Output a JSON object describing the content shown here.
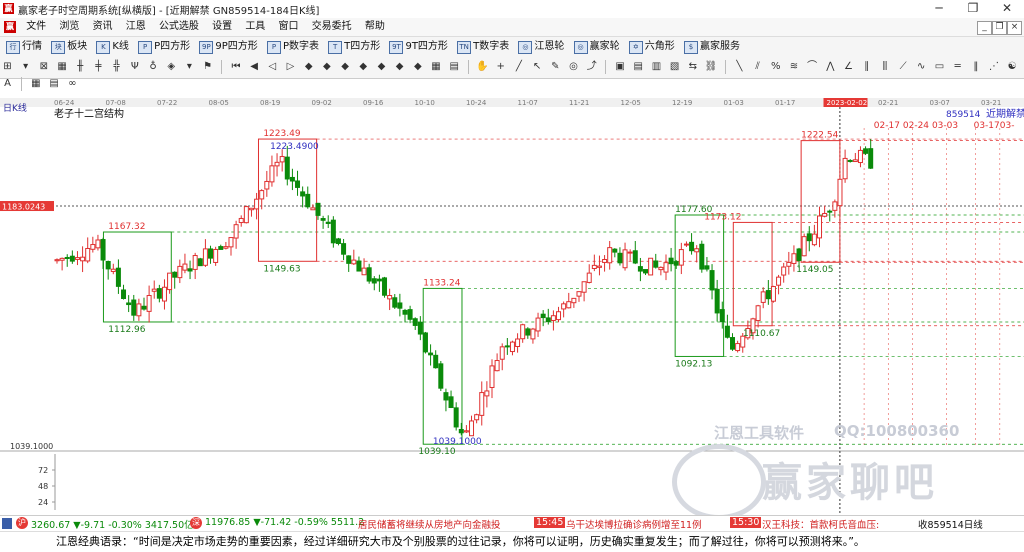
{
  "window": {
    "title": "赢家老子时空周期系统[纵横版] - [近期解禁  GN859514-184日K线]",
    "minimize": "─",
    "maximize": "❐",
    "close": "✕"
  },
  "menu": {
    "items": [
      "文件",
      "浏览",
      "资讯",
      "江恩",
      "公式选股",
      "设置",
      "工具",
      "窗口",
      "交易委托",
      "帮助"
    ]
  },
  "toolbar1": {
    "items": [
      {
        "icon": "行",
        "label": "行情"
      },
      {
        "icon": "块",
        "label": "板块"
      },
      {
        "icon": "K",
        "label": "K线"
      },
      {
        "icon": "P",
        "label": "P四方形"
      },
      {
        "icon": "9P",
        "label": "9P四方形"
      },
      {
        "icon": "P",
        "label": "P数字表"
      },
      {
        "icon": "T",
        "label": "T四方形"
      },
      {
        "icon": "9T",
        "label": "9T四方形"
      },
      {
        "icon": "TN",
        "label": "T数字表"
      },
      {
        "icon": "◎",
        "label": "江恩轮"
      },
      {
        "icon": "◎",
        "label": "赢家轮"
      },
      {
        "icon": "✡",
        "label": "六角形"
      },
      {
        "icon": "$",
        "label": "赢家服务"
      }
    ]
  },
  "chart_data": {
    "type": "candlestick",
    "title": "老子十二宫结构",
    "period_label": "日K线",
    "symbol_label": "859514",
    "name_label": "近期解禁",
    "x_ticks": [
      "06-24",
      "07-08",
      "07-22",
      "08-05",
      "08-19",
      "09-02",
      "09-16",
      "10-10",
      "10-24",
      "11-07",
      "11-21",
      "12-05",
      "12-19",
      "01-03",
      "01-17",
      "2023-02-02",
      "02-21",
      "03-07",
      "03-21"
    ],
    "y_ticks": [
      "1039.1000",
      "72",
      "48",
      "24"
    ],
    "y_range": [
      1035,
      1235
    ],
    "current_price_label": "1183.0243",
    "current_price": 1183.0243,
    "price_labels": [
      {
        "text": "1223.49",
        "price": 1223.49
      },
      {
        "text": "1223.4900",
        "price": 1223.49
      },
      {
        "text": "1167.32",
        "price": 1167.32
      },
      {
        "text": "1149.63",
        "price": 1149.63
      },
      {
        "text": "1112.96",
        "price": 1112.96
      },
      {
        "text": "1133.24",
        "price": 1133.24
      },
      {
        "text": "1039.1000",
        "price": 1039.1
      },
      {
        "text": "1039.10",
        "price": 1039.1
      },
      {
        "text": "1177.60",
        "price": 1177.6
      },
      {
        "text": "1173.12",
        "price": 1173.12
      },
      {
        "text": "1092.13",
        "price": 1092.13
      },
      {
        "text": "1110.67",
        "price": 1110.67
      },
      {
        "text": "1222.54",
        "price": 1222.54
      },
      {
        "text": "1149.05",
        "price": 1149.05
      }
    ],
    "future_labels": [
      "02-17",
      "02-24",
      "03-03",
      "03-17",
      "03-"
    ],
    "boxes": [
      {
        "color": "green",
        "from": 0.05,
        "to": 0.12,
        "high": 1167.32,
        "low": 1112.96
      },
      {
        "color": "red",
        "from": 0.21,
        "to": 0.27,
        "high": 1223.49,
        "low": 1149.63
      },
      {
        "color": "green",
        "from": 0.38,
        "to": 0.42,
        "high": 1133.24,
        "low": 1039.1
      },
      {
        "color": "green",
        "from": 0.64,
        "to": 0.69,
        "high": 1177.6,
        "low": 1092.13
      },
      {
        "color": "red",
        "from": 0.7,
        "to": 0.74,
        "high": 1173.12,
        "low": 1110.67
      },
      {
        "color": "red",
        "from": 0.77,
        "to": 0.81,
        "high": 1222.54,
        "low": 1149.05
      }
    ]
  },
  "watermark": {
    "brand": "江恩工具软件",
    "qq": "QQ:100800360",
    "logo": "赢家聊吧"
  },
  "status": {
    "index1": "3260.67 ▼-9.71 -0.30% 3417.50亿",
    "index2": "11976.85 ▼-71.42 -0.59% 5511.2",
    "news1": "居民储蓄将继续从房地产向金融投",
    "time1": "15:45",
    "news2": "乌干达埃博拉确诊病例增至11例",
    "time2": "15:30",
    "news3": "汉王科技：首款柯氏音血压:",
    "symbol": "收859514日线"
  },
  "quote": {
    "text": "江恩经典语录：“时间是决定市场走势的重要因素，经过详细研究大市及个别股票的过往记录，你将可以证明，历史确实重复发生；而了解过往，你将可以预测将来。”。"
  },
  "colors": {
    "up": "#e03030",
    "down": "#0a8a0a",
    "box_green": "#1a9a1a",
    "box_red": "#e03030",
    "price_bg": "#e53935",
    "accent_text": "#3030c0"
  }
}
